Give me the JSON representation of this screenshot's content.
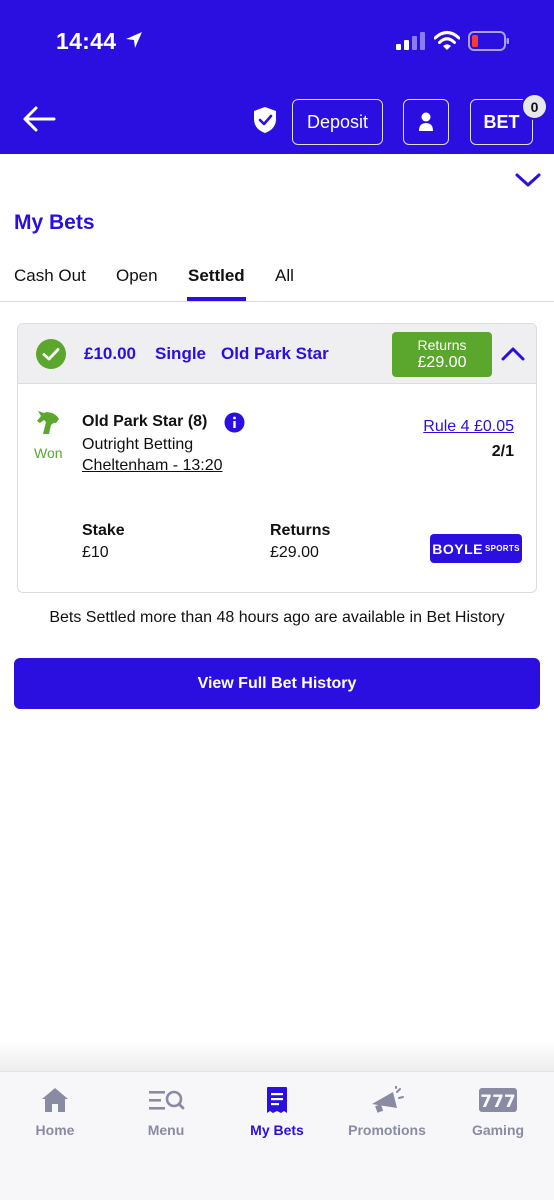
{
  "status_bar": {
    "time": "14:44"
  },
  "header": {
    "deposit_label": "Deposit",
    "betslip_label": "BET",
    "betslip_count": "0"
  },
  "page": {
    "title": "My Bets"
  },
  "tabs": [
    {
      "label": "Cash Out"
    },
    {
      "label": "Open"
    },
    {
      "label": "Settled",
      "active": true
    },
    {
      "label": "All"
    }
  ],
  "bet": {
    "stake": "£10.00",
    "bet_type": "Single",
    "selection": "Old Park Star",
    "returns_label": "Returns",
    "returns_value": "£29.00",
    "result": "Won",
    "selection_detail": "Old Park Star (8)",
    "market": "Outright Betting",
    "event": "Cheltenham - 13:20",
    "rule4": "Rule 4 £0.05",
    "odds": "2/1",
    "stake_label": "Stake",
    "stake_value": "£10",
    "returns_footer_label": "Returns",
    "returns_footer_value": "£29.00",
    "brand_main": "BOYLE",
    "brand_sub": "SPORTS"
  },
  "notice": "Bets Settled more than 48 hours ago are available in Bet History",
  "history_button": "View Full Bet History",
  "bottom_nav": [
    {
      "label": "Home",
      "icon": "home-icon"
    },
    {
      "label": "Menu",
      "icon": "menu-search-icon"
    },
    {
      "label": "My Bets",
      "icon": "receipt-icon",
      "active": true
    },
    {
      "label": "Promotions",
      "icon": "megaphone-icon"
    },
    {
      "label": "Gaming",
      "icon": "slot-777-icon"
    }
  ],
  "colors": {
    "brand": "#2a0fe0",
    "won": "#5ba72e",
    "nav_inactive": "#8a8aa3"
  }
}
